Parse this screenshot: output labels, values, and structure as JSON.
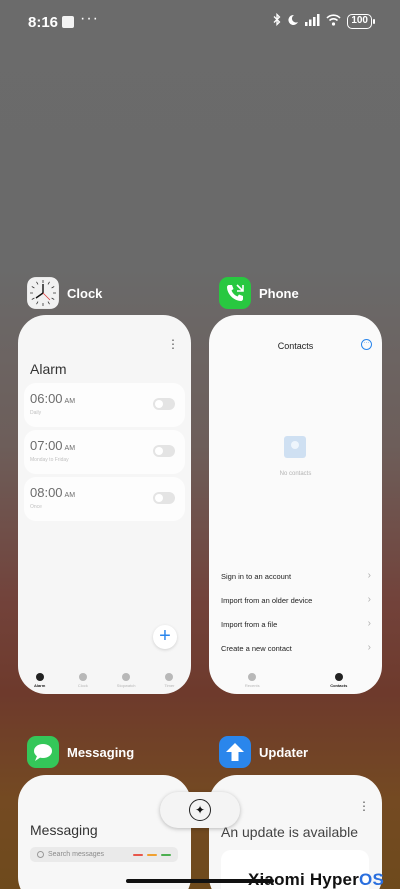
{
  "status": {
    "time": "8:16",
    "dots": "···",
    "icons": [
      "bluetooth-icon",
      "moon-icon",
      "signal-icon",
      "wifi-icon"
    ],
    "battery": "100"
  },
  "apps": {
    "clock": {
      "name": "Clock",
      "screen": {
        "title": "Alarm",
        "alarms": [
          {
            "time": "06:00",
            "ampm": "AM",
            "sub": "Daily"
          },
          {
            "time": "07:00",
            "ampm": "AM",
            "sub": "Monday to Friday"
          },
          {
            "time": "08:00",
            "ampm": "AM",
            "sub": "Once"
          }
        ],
        "fab": "+",
        "tabs": [
          "Alarm",
          "Clock",
          "Stopwatch",
          "Timer"
        ]
      }
    },
    "phone": {
      "name": "Phone",
      "screen": {
        "title": "Contacts",
        "empty": "No contacts",
        "options": [
          "Sign in to an account",
          "Import from an older device",
          "Import from a file",
          "Create a new contact"
        ],
        "tabs": [
          "Recents",
          "Contacts"
        ]
      }
    },
    "messaging": {
      "name": "Messaging",
      "screen": {
        "title": "Messaging",
        "search_placeholder": "Search messages"
      }
    },
    "updater": {
      "name": "Updater",
      "screen": {
        "title": "An update is available",
        "brand": "Xiaomi Hyper",
        "brand_os": "OS"
      }
    }
  },
  "colors": {
    "accent": "#2a86ec",
    "phone_green": "#28c840",
    "msg_green": "#34c759",
    "updater_blue": "#2a86ec"
  }
}
